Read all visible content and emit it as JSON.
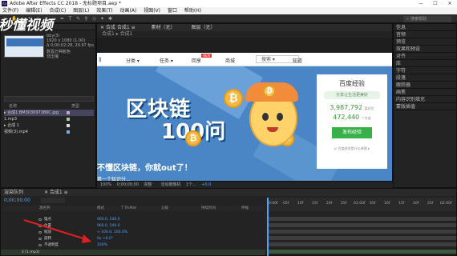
{
  "window": {
    "title": "Adobe After Effects CC 2018 - 无标题项目.aep *",
    "logo": "Ae",
    "min_glyph": "—",
    "max_glyph": "☐",
    "close_glyph": "✕"
  },
  "menu": [
    "文件(F)",
    "编辑(E)",
    "合成(C)",
    "图层(L)",
    "效果(T)",
    "动画(A)",
    "视图(V)",
    "窗口",
    "帮助(H)"
  ],
  "toolbar": {
    "search_placeholder": "搜索帮助"
  },
  "project": {
    "tab_label": "项目  ≡",
    "item_name": "bby(3)",
    "item_meta1": "1920 x 1080 (1.00)",
    "item_meta2": "Δ 0;00;02;28, 29.97 fps",
    "item_extra1": "数百万种颜色",
    "item_extra2": "非压缩",
    "watermark": "秒懂视频",
    "col_name": "名称",
    "col_type": "类型",
    "rows": [
      "▸ 合成1  BM303097386C.jpg",
      "  1.mp3",
      "▸ 合成 1",
      "  视频(3).mp4"
    ]
  },
  "composition": {
    "tabs": [
      "✕ 合成 合成1 ≡",
      "素材（无）",
      "图层（无）"
    ],
    "nav_label": "合成1 ▸ 合成1",
    "site_nav": {
      "items": [
        "分类 ▾",
        "任务 ▾",
        "回享",
        "商城",
        "知道"
      ],
      "badge": "NEW",
      "search_button": "搜索 ▾"
    },
    "hero": {
      "title_line1": "区块链",
      "title_line2": "100问",
      "subtitle": "不懂区块链，你就out了！",
      "subtitle2": "第一个知识分..."
    },
    "card": {
      "title": "百度经验",
      "banner": "分享让生活更美好",
      "stat1_value": "3,987,792",
      "stat1_label": "篇经验",
      "stat2_value": "472,440",
      "stat2_label": "个作者",
      "button": "发布经验",
      "link": "☑ 百度经验是什么原理 ▸"
    },
    "viewer_bar": {
      "zoom": "100%",
      "timecode": "0;00;00;00",
      "resolution": "完整",
      "camera": "活动摄像机",
      "views": "1个...",
      "exposure": "+0.0"
    }
  },
  "right_panel": {
    "items": [
      "信息",
      "音频",
      "预览",
      "效果和预设",
      "对齐",
      "库",
      "字符",
      "段落",
      "跟踪器",
      "画笔",
      "内容识别填充",
      "蒙版插值"
    ]
  },
  "timeline": {
    "tabs": [
      "渲染队列",
      "✕ 合成1 ≡"
    ],
    "timecode": "0;00;00;00",
    "columns": [
      "源名称",
      "模式",
      "T TrkMat",
      "父级",
      "持续时间",
      "伸缩"
    ],
    "layers": [
      {
        "name": "锚点",
        "value": "960.0, 540.0"
      },
      {
        "name": "位置",
        "value": "960.0, 540.0"
      },
      {
        "name": "缩放",
        "value": "∞ 100.0, 100.0%"
      },
      {
        "name": "旋转",
        "value": "0x +0.0°"
      },
      {
        "name": "不透明度",
        "value": "100%"
      },
      {
        "name": "2  [1.mp3]",
        "value": ""
      }
    ],
    "ruler_ticks": [
      "0:00f",
      "05f",
      "10f",
      "15f",
      "20f",
      "25f",
      "01:00f",
      "05f",
      "10f",
      "15f",
      "20f",
      "25f",
      "02:00f"
    ]
  }
}
